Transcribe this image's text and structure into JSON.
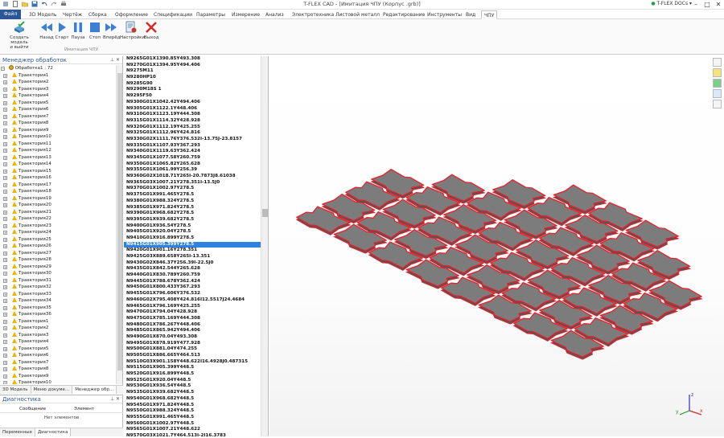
{
  "window": {
    "title": "T-FLEX CAD - [Имитация ЧПУ (Корпус .grb)]"
  },
  "window_controls": {
    "minimize": "–",
    "maximize": "□",
    "close": "✕"
  },
  "account": {
    "label": "T-FLEX DOCs"
  },
  "menu": {
    "file": "Файл",
    "tabs": [
      "3D Модель",
      "Чертёж",
      "Сборка",
      "Оформление",
      "Спецификации",
      "Параметры",
      "Измерение",
      "Анализ",
      "Электротехника",
      "Листовой металл",
      "Редактирование",
      "Инструменты",
      "Вид",
      "ЧПУ"
    ],
    "active": "ЧПУ"
  },
  "ribbon": {
    "buttons": [
      {
        "id": "create",
        "label": "Создать модель\nи выйти",
        "icon": "model-check-icon"
      },
      {
        "id": "back",
        "label": "Назад",
        "icon": "rewind-icon"
      },
      {
        "id": "start",
        "label": "Старт",
        "icon": "play-icon"
      },
      {
        "id": "pause",
        "label": "Пауза",
        "icon": "pause-icon"
      },
      {
        "id": "stop",
        "label": "Стоп",
        "icon": "stop-icon"
      },
      {
        "id": "forward",
        "label": "Вперёд",
        "icon": "fast-forward-icon"
      },
      {
        "id": "settings",
        "label": "Настройки",
        "icon": "settings-icon"
      },
      {
        "id": "exit",
        "label": "Выход",
        "icon": "close-icon"
      }
    ],
    "group_label": "Имитация ЧПУ"
  },
  "manager": {
    "title": "Менеджер обработок",
    "pins": "⊥ ✕",
    "root": "Обработка1 : 72",
    "items": [
      "Траектория1",
      "Траектория2",
      "Траектория3",
      "Траектория4",
      "Траектория5",
      "Траектория6",
      "Траектория7",
      "Траектория8",
      "Траектория9",
      "Траектория10",
      "Траектория11",
      "Траектория12",
      "Траектория13",
      "Траектория14",
      "Траектория15",
      "Траектория16",
      "Траектория17",
      "Траектория18",
      "Траектория19",
      "Траектория20",
      "Траектория21",
      "Траектория22",
      "Траектория23",
      "Траектория24",
      "Траектория25",
      "Траектория26",
      "Траектория27",
      "Траектория28",
      "Траектория29",
      "Траектория30",
      "Траектория31",
      "Траектория32",
      "Траектория33",
      "Траектория34",
      "Траектория35",
      "Траектория36",
      "Траектория1",
      "Траектория2",
      "Траектория3",
      "Траектория4",
      "Траектория5",
      "Траектория6",
      "Траектория7",
      "Траектория8",
      "Траектория9",
      "Траектория10"
    ],
    "tabs": [
      "3D Модель",
      "Меню докуме...",
      "Менеджер обр..."
    ],
    "active_tab": "Менеджер обр..."
  },
  "diagnostics": {
    "title": "Диагностика",
    "pins": "⊥ ✕",
    "columns": [
      "Сообщение",
      "Элемент"
    ],
    "empty_text": "Нет элементов",
    "tabs": [
      "Переменные",
      "Диагностика"
    ],
    "active_tab": "Диагностика"
  },
  "program": {
    "selected_index": 30,
    "lines": [
      "N9265G01X1390.85Y493.308",
      "N9270G01X1394.95Y494.406",
      "N9275M11",
      "N9280HP10",
      "N9285G90",
      "N9290M18S 1",
      "N9295F50",
      "N9300G01X1042.42Y494.406",
      "N9305G01X1122.1Y448.406",
      "N9310G01X1123.19Y444.308",
      "N9315G01X1114.32Y428.928",
      "N9320G01X1112.19Y425.255",
      "N9325G01X1112.96Y424.816",
      "N9330G02X1111.76Y376.532I-13.75J-23.8157",
      "N9335G01X1107.93Y367.293",
      "N9340G01X1119.63Y362.424",
      "N9345G01X1077.58Y260.759",
      "N9350G01X1065.82Y265.628",
      "N9355G01X1061.99Y256.39",
      "N9360G02X1018.71Y265I-20.7873J8.61038",
      "N9365G03X1007.21Y278.351I-13.5J0",
      "N9370G01X1002.97Y278.5",
      "N9375G01X991.465Y278.5",
      "N9380G01X988.324Y278.5",
      "N9385G01X971.824Y278.5",
      "N9390G01X968.682Y278.5",
      "N9395G01X939.682Y278.5",
      "N9400G01X936.54Y278.5",
      "N9405G01X920.04Y278.5",
      "N9410G01X916.899Y278.5",
      "N9415G01X905.399Y278.5",
      "N9420G01X901.16Y278.351",
      "N9425G03X889.658Y265I-13.351",
      "N9430G02X846.37Y256.39I-22.5J0",
      "N9435G01X842.544Y265.628",
      "N9440G01X830.789Y260.759",
      "N9445G01X788.678Y362.424",
      "N9450G01X800.433Y367.293",
      "N9455G01X796.606Y376.532",
      "N9460G02X795.408Y424.816I12.5517J24.4684",
      "N9465G01X796.169Y425.255",
      "N9470G01X794.04Y428.928",
      "N9475G01X785.169Y444.308",
      "N9480G01X786.267Y448.406",
      "N9485G01X865.942Y494.406",
      "N9490G01X870.04Y493.308",
      "N9495G01X878.919Y477.928",
      "N9500G01X881.04Y474.255",
      "N9505G01X886.665Y464.513",
      "N9510G03X901.158Y448.622I16.4928J0.487315",
      "N9515G01X905.399Y448.5",
      "N9520G01X916.899Y448.5",
      "N9525G01X920.04Y448.5",
      "N9530G01X936.54Y448.5",
      "N9535G01X939.682Y448.5",
      "N9540G01X968.682Y448.5",
      "N9545G01X971.824Y448.5",
      "N9550G01X988.324Y448.5",
      "N9555G01X991.465Y448.5",
      "N9560G01X1002.97Y448.5",
      "N9565G01X1007.21Y448.622",
      "N9570G03X1021.7Y464.513I-2J16.3783",
      "N9575G01X1027.32Y474.255"
    ]
  },
  "viewport": {
    "sheet_color": "#7c7c7c",
    "edge_color": "#e8202a",
    "axes": {
      "x": "x",
      "y": "y",
      "z": "z"
    }
  }
}
